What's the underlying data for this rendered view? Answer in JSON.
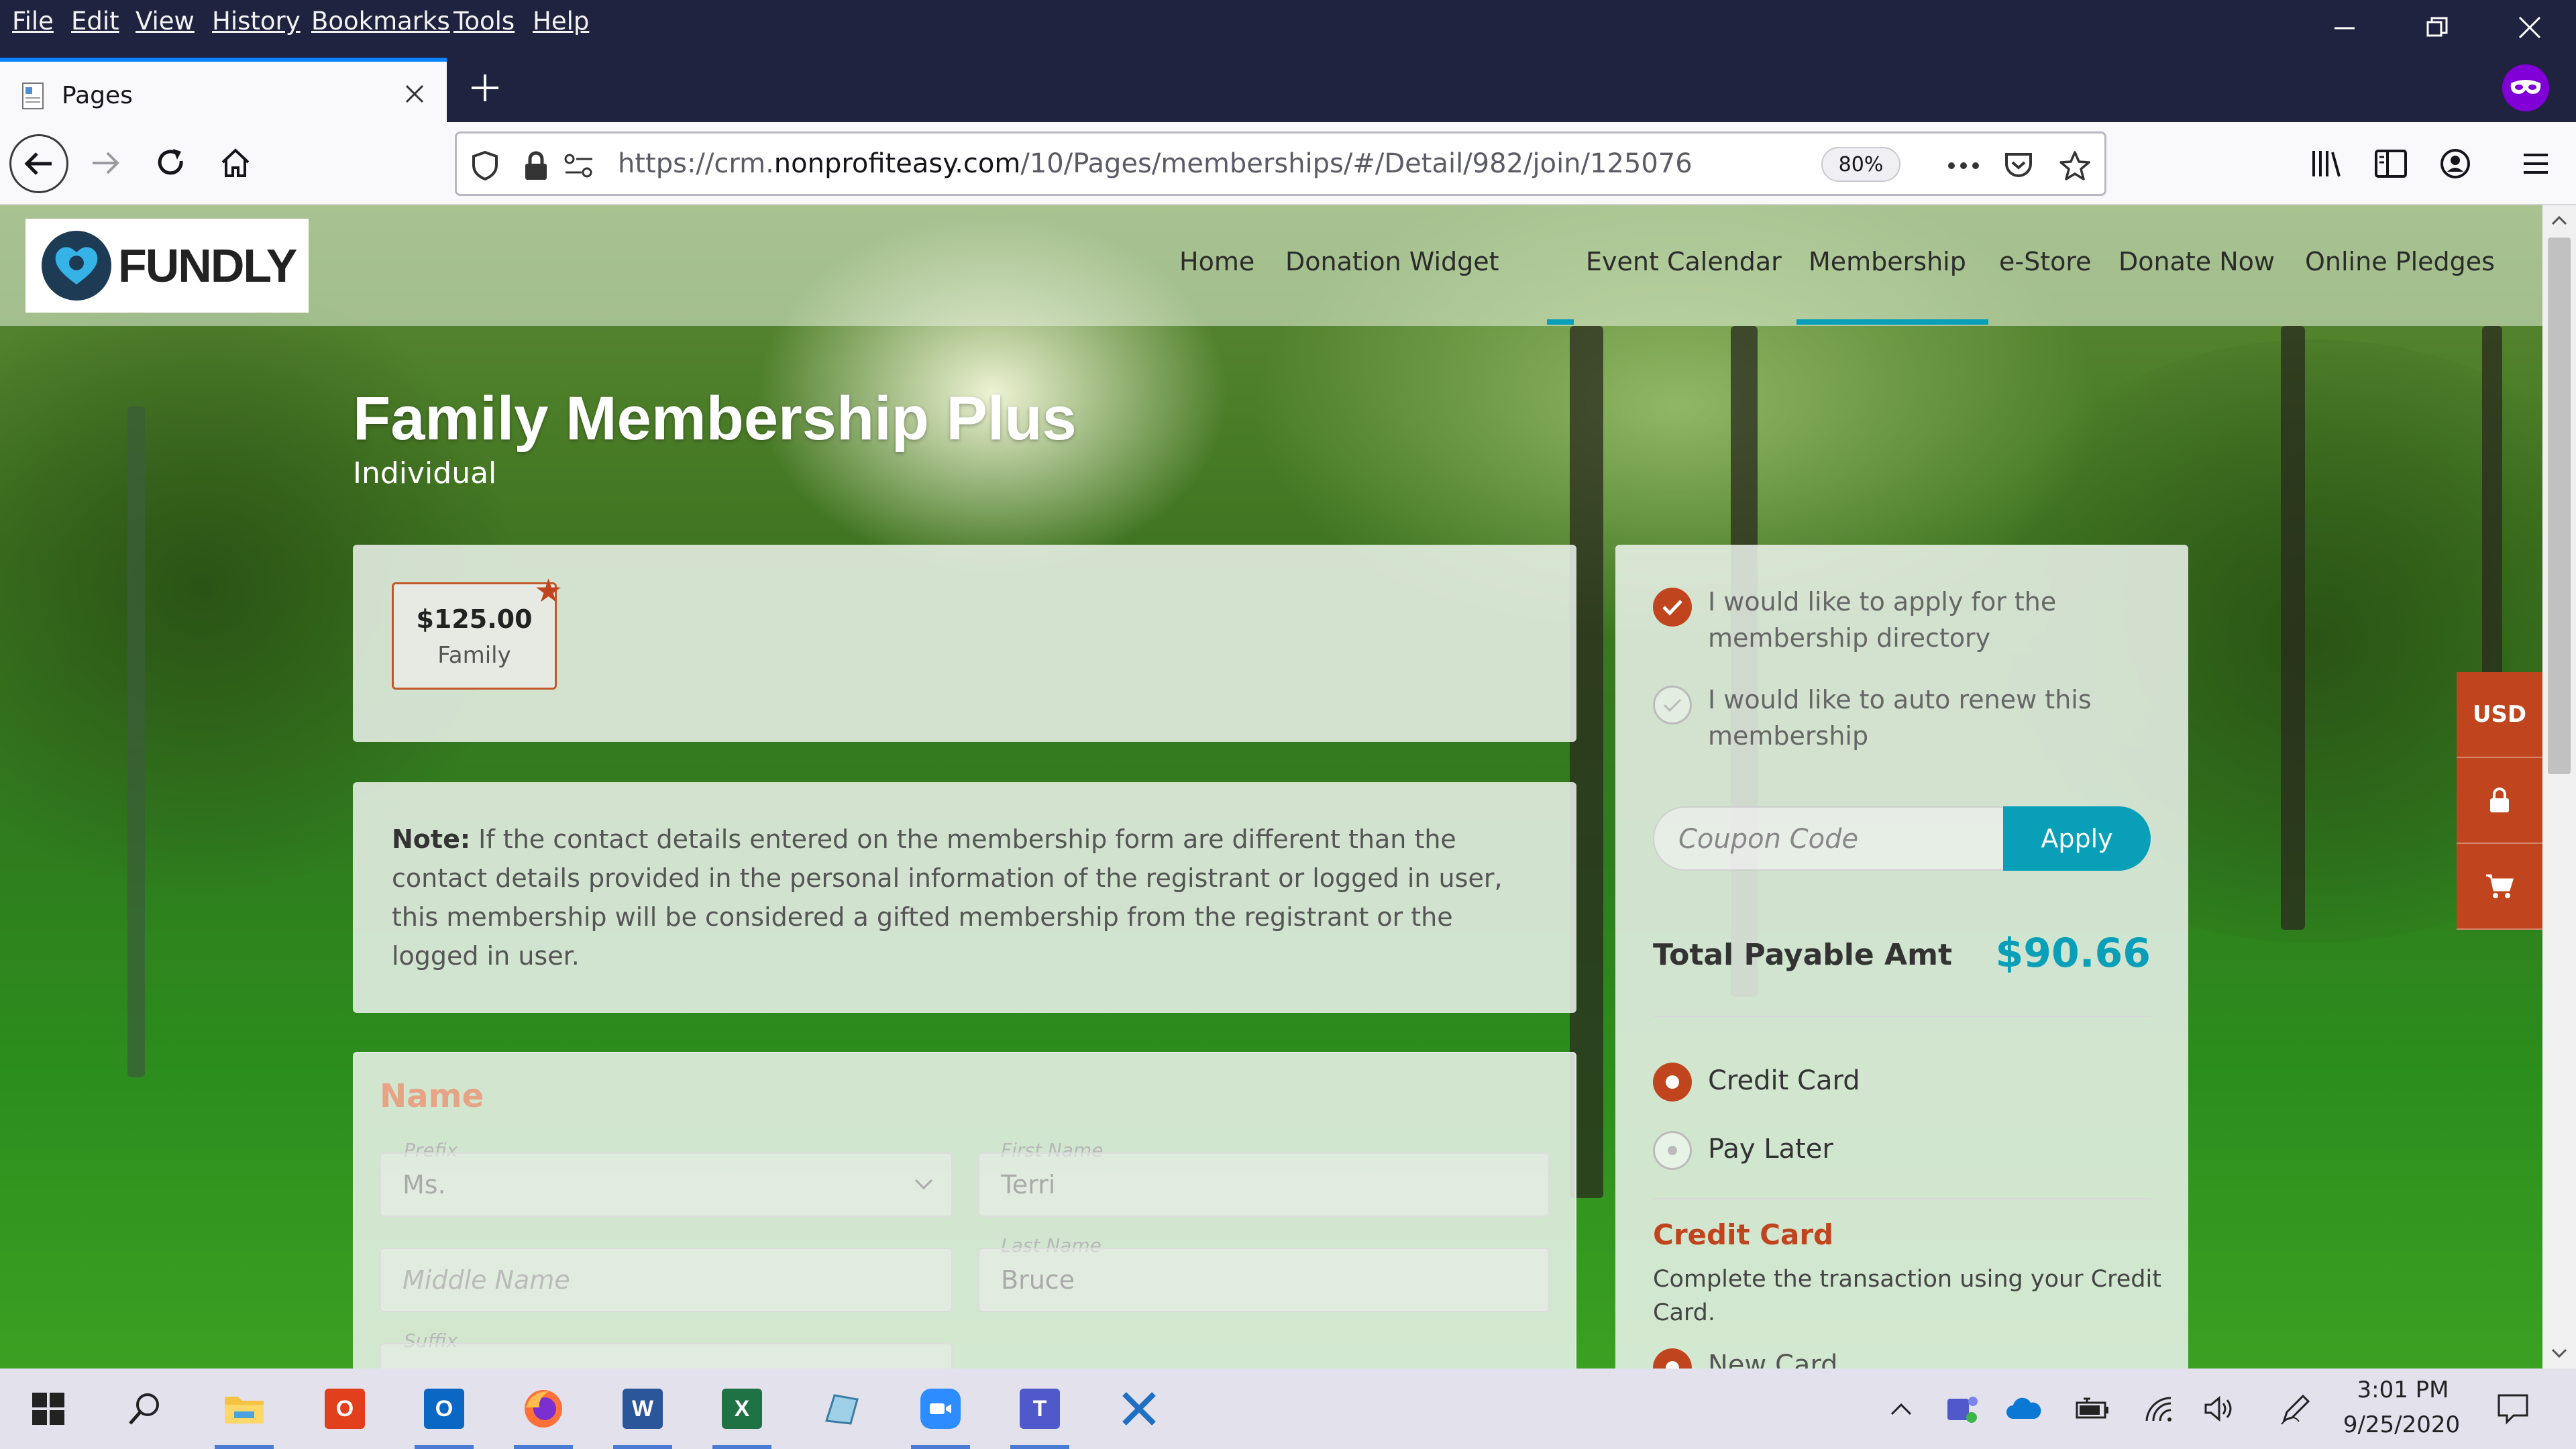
{
  "browser": {
    "menu": [
      "File",
      "Edit",
      "View",
      "History",
      "Bookmarks",
      "Tools",
      "Help"
    ],
    "tab_title": "Pages",
    "url_prefix": "https://crm.",
    "url_domain": "nonprofiteasy.com",
    "url_path": "/10/Pages/memberships/#/Detail/982/join/125076",
    "zoom": "80%",
    "accent_color": "#0a84ff"
  },
  "site": {
    "logo_text": "FUNDLY",
    "nav": [
      "Home",
      "Donation Widget",
      "Event Calendar",
      "Membership",
      "e-Store",
      "Donate Now",
      "Online Pledges"
    ],
    "active_nav": "Membership",
    "accent_color": "#0a9fb8",
    "brand_color": "#c0451e"
  },
  "hero": {
    "title": "Family Membership Plus",
    "subtitle": "Individual"
  },
  "membership": {
    "price": "$125.00",
    "price_label": "Family"
  },
  "note": {
    "label": "Note:",
    "text": "If the contact details entered on the membership form are different than the contact details provided in the personal information of the registrant or logged in user, this membership will be considered a gifted membership from the registrant or the logged in user."
  },
  "form": {
    "section_title": "Name",
    "prefix_label": "Prefix",
    "prefix_value": "Ms.",
    "first_name_label": "First Name",
    "first_name_value": "Terri",
    "middle_name_placeholder": "Middle Name",
    "last_name_label": "Last Name",
    "last_name_value": "Bruce",
    "suffix_label": "Suffix"
  },
  "sidebar": {
    "directory_option": "I would like to apply for the membership directory",
    "directory_checked": true,
    "auto_renew_option": "I would like to auto renew this membership",
    "auto_renew_checked": false,
    "coupon_placeholder": "Coupon Code",
    "apply_label": "Apply",
    "total_label": "Total Payable Amt",
    "total_value": "$90.66",
    "payment_options": [
      "Credit Card",
      "Pay Later"
    ],
    "selected_payment": "Credit Card",
    "cc_heading": "Credit Card",
    "cc_description": "Complete the transaction using your Credit Card.",
    "cc_next_option": "New Card"
  },
  "side_widgets": {
    "currency": "USD"
  },
  "taskbar": {
    "time": "3:01 PM",
    "date": "9/25/2020"
  }
}
